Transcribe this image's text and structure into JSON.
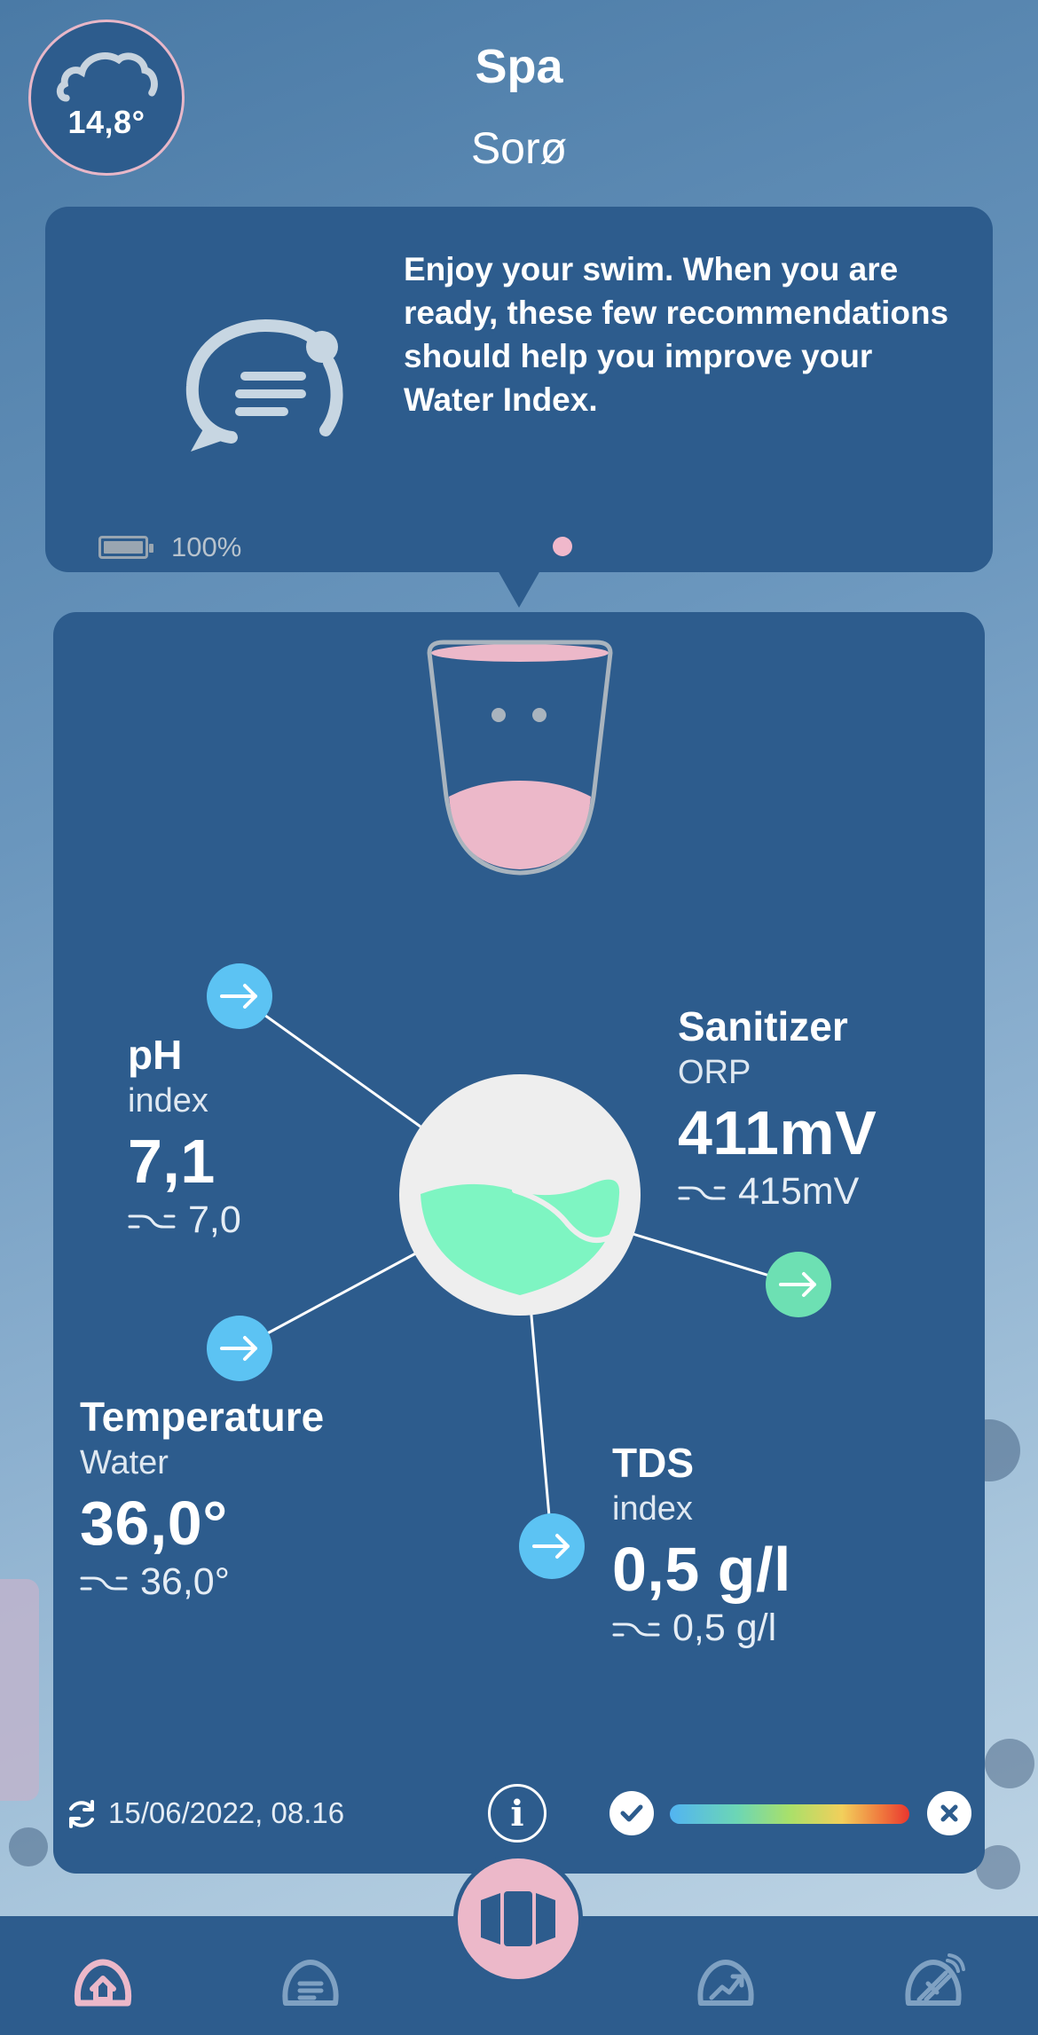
{
  "header": {
    "weather_temp": "14,8°",
    "weather_icon": "cloud-icon",
    "title": "Spa",
    "subtitle": "Sorø"
  },
  "message": {
    "icon": "chat-gauge-icon",
    "text": "Enjoy your swim. When you are ready, these few recommendations should help you improve your Water Index.",
    "battery_icon": "battery-icon",
    "battery_level": 1.0,
    "battery_label": "100%"
  },
  "readings": {
    "ph": {
      "title": "pH",
      "sub": "index",
      "value": "7,1",
      "previous": "7,0"
    },
    "sanitizer": {
      "title": "Sanitizer",
      "sub": "ORP",
      "value": "411mV",
      "previous": "415mV"
    },
    "temperature": {
      "title": "Temperature",
      "sub": "Water",
      "value": "36,0°",
      "previous": "36,0°"
    },
    "tds": {
      "title": "TDS",
      "sub": "index",
      "value": "0,5 g/l",
      "previous": "0,5 g/l"
    }
  },
  "footer": {
    "timestamp": "15/06/2022, 08.16",
    "info_label": "i"
  },
  "colors": {
    "card": "#2d5c8d",
    "accent_pink": "#ecb8c9",
    "arrow_blue": "#5cc3f3",
    "arrow_green": "#6de0b3",
    "water_green": "#7ef5c2"
  },
  "nav": {
    "items": [
      "home-icon",
      "messages-icon",
      "floating-device-icon",
      "trend-icon",
      "remote-settings-icon"
    ],
    "active": "home-icon"
  }
}
